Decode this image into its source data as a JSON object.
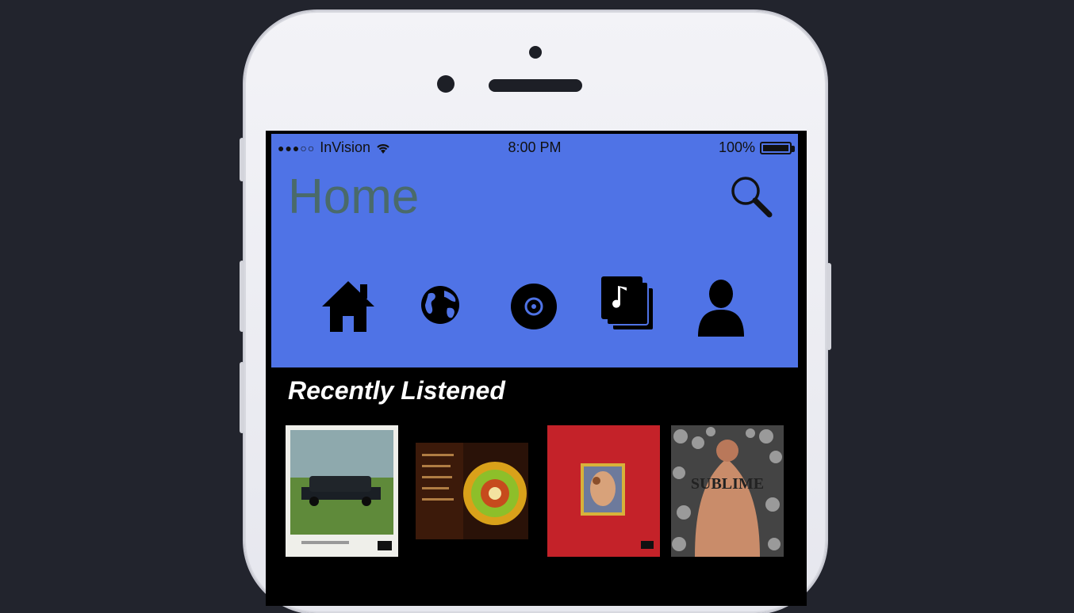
{
  "status_bar": {
    "carrier_dots": "●●●○○",
    "carrier": "InVision",
    "time": "8:00 PM",
    "battery": "100%"
  },
  "header": {
    "title": "Home",
    "search_icon": "search-icon"
  },
  "nav": {
    "items": [
      {
        "icon": "home-icon"
      },
      {
        "icon": "globe-icon"
      },
      {
        "icon": "disc-icon"
      },
      {
        "icon": "music-library-icon"
      },
      {
        "icon": "profile-icon"
      }
    ]
  },
  "recently_listened": {
    "title": "Recently Listened",
    "albums": [
      {
        "art": "album-cover-van-field"
      },
      {
        "art": "album-cover-psychedelic-dark"
      },
      {
        "art": "album-cover-red-painting"
      },
      {
        "art": "album-cover-tattoo-back",
        "cover_text": "SUBLIME"
      }
    ]
  },
  "colors": {
    "header_blue": "#4f73e6",
    "background": "#22242d",
    "title_gray": "#4a6a6a"
  }
}
